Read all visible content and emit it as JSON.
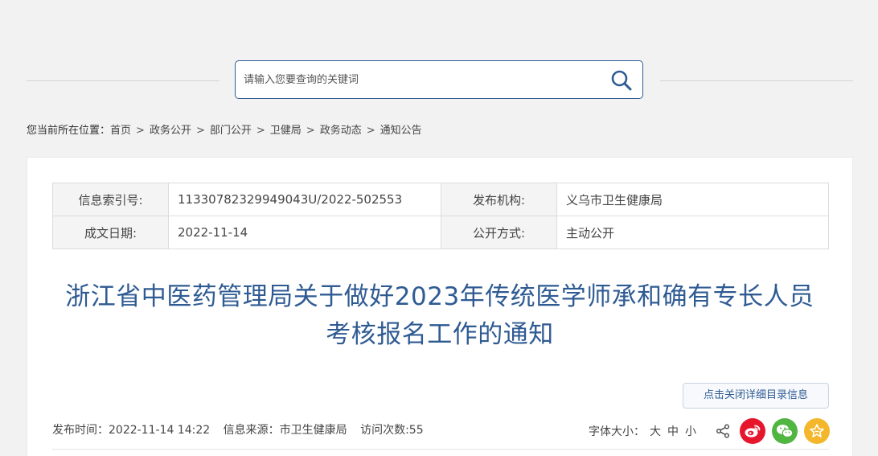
{
  "search": {
    "placeholder": "请输入您要查询的关键词"
  },
  "breadcrumb": {
    "prefix": "您当前所在位置：",
    "items": [
      "首页",
      "政务公开",
      "部门公开",
      "卫健局",
      "政务动态",
      "通知公告"
    ],
    "separator": ">"
  },
  "meta": {
    "index_label": "信息索引号:",
    "index_value": "11330782329949043U/2022-502553",
    "publisher_label": "发布机构:",
    "publisher_value": "义乌市卫生健康局",
    "date_label": "成文日期:",
    "date_value": "2022-11-14",
    "method_label": "公开方式:",
    "method_value": "主动公开"
  },
  "article": {
    "title_line1": "浙江省中医药管理局关于做好2023年传统医学师承和确有专长人员",
    "title_line2": "考核报名工作的通知",
    "toggle_label": "点击关闭详细目录信息",
    "publish_time": "发布时间：2022-11-14 14:22",
    "source": "信息来源：市卫生健康局",
    "visits": "访问次数:55"
  },
  "tools": {
    "font_label": "字体大小：",
    "font_large": "大",
    "font_medium": "中",
    "font_small": "小",
    "icons": [
      "share-icon",
      "weibo-icon",
      "wechat-icon",
      "favorite-icon"
    ]
  },
  "colors": {
    "accent": "#2f5b93",
    "weibo": "#e6162d",
    "wechat": "#51b541",
    "favorite": "#f4b62b"
  }
}
